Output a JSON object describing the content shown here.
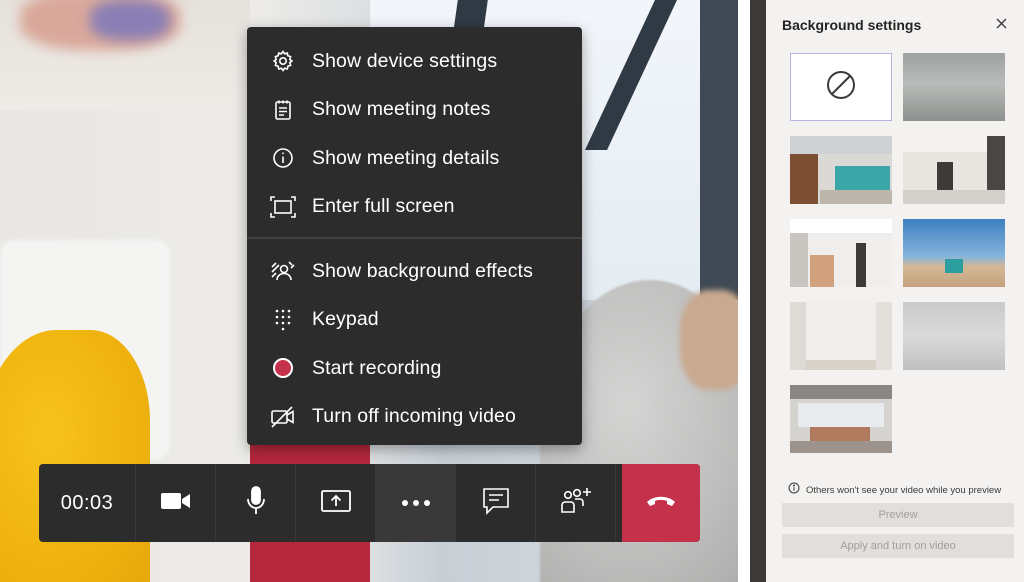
{
  "menu": {
    "items": [
      {
        "label": "Show device settings",
        "icon": "gear-icon"
      },
      {
        "label": "Show meeting notes",
        "icon": "notes-icon"
      },
      {
        "label": "Show meeting details",
        "icon": "info-icon"
      },
      {
        "label": "Enter full screen",
        "icon": "fullscreen-icon"
      },
      {
        "label": "Show background effects",
        "icon": "background-effects-icon"
      },
      {
        "label": "Keypad",
        "icon": "keypad-icon"
      },
      {
        "label": "Start recording",
        "icon": "record-icon"
      },
      {
        "label": "Turn off incoming video",
        "icon": "video-off-icon"
      }
    ]
  },
  "callbar": {
    "timer": "00:03",
    "buttons": [
      "camera-icon",
      "microphone-icon",
      "share-screen-icon",
      "more-options-icon",
      "chat-icon",
      "participants-icon",
      "hang-up-icon"
    ],
    "hangup_color": "#c4314b"
  },
  "panel": {
    "title": "Background settings",
    "note": "Others won't see your video while you preview",
    "preview_label": "Preview",
    "apply_label": "Apply and turn on video",
    "selection_color": "#b5b2e6"
  },
  "colors": {
    "menu_bg": "#2d2c2c",
    "panel_bg": "#f3f2f1",
    "accent_red": "#c4314b"
  }
}
